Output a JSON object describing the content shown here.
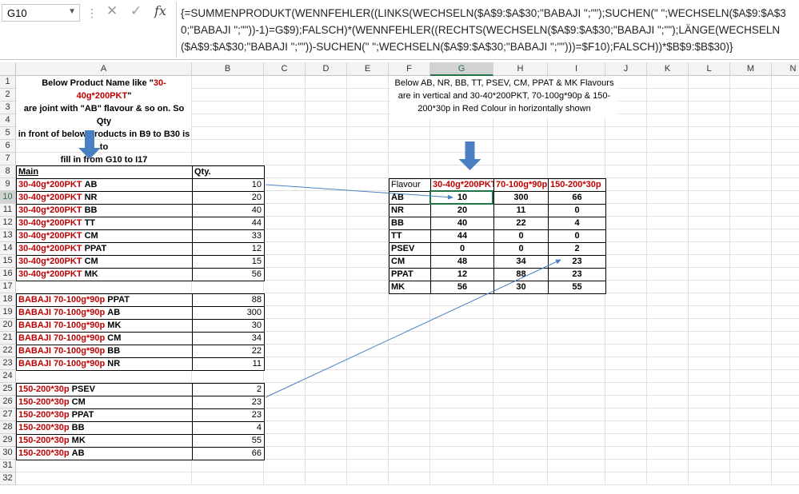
{
  "namebox": {
    "value": "G10"
  },
  "formula": "{=SUMMENPRODUKT(WENNFEHLER((LINKS(WECHSELN($A$9:$A$30;\"BABAJI \";\"\");SUCHEN(\" \";WECHSELN($A$9:$A$30;\"BABAJI \";\"\"))-1)=G$9);FALSCH)*(WENNFEHLER((RECHTS(WECHSELN($A$9:$A$30;\"BABAJI \";\"\");LÄNGE(WECHSELN($A$9:$A$30;\"BABAJI \";\"\"))-SUCHEN(\" \";WECHSELN($A$9:$A$30;\"BABAJI \";\"\")))=$F10);FALSCH))*$B$9:$B$30)}",
  "columns": [
    "A",
    "B",
    "C",
    "D",
    "E",
    "F",
    "G",
    "H",
    "I",
    "J",
    "K",
    "L",
    "M",
    "N"
  ],
  "rows": [
    "1",
    "2",
    "3",
    "4",
    "5",
    "6",
    "7",
    "8",
    "9",
    "10",
    "11",
    "12",
    "13",
    "14",
    "15",
    "16",
    "17",
    "18",
    "19",
    "20",
    "21",
    "22",
    "23",
    "24",
    "25",
    "26",
    "27",
    "28",
    "29",
    "30",
    "31",
    "32"
  ],
  "note_left": {
    "l1a": "Below Product Name like \"",
    "l1b": "30-40g*200PKT",
    "l1c": "\"",
    "l2": "are joint with \"AB\" flavour & so on. So Qty",
    "l3": "in front of below products in B9 to B30 is to",
    "l4": "fill in from G10 to I17"
  },
  "note_right": {
    "p1": "Below ",
    "p2": "AB, NR, BB, TT, PSEV, CM, PPAT & MK",
    "p3": " Flavours",
    "p4": "are in vertical and ",
    "p5": "30-40*200PKT, 70-100g*90p & 150-",
    "p6": "200*30p",
    "p7": " in Red Colour in horizontally shown"
  },
  "left_header": {
    "main": "Main",
    "qty": "Qty."
  },
  "left_table": [
    {
      "row": "9",
      "prod": "30-40g*200PKT",
      "flav": "AB",
      "qty": "10"
    },
    {
      "row": "10",
      "prod": "30-40g*200PKT",
      "flav": "NR",
      "qty": "20"
    },
    {
      "row": "11",
      "prod": "30-40g*200PKT",
      "flav": "BB",
      "qty": "40"
    },
    {
      "row": "12",
      "prod": "30-40g*200PKT",
      "flav": "TT",
      "qty": "44"
    },
    {
      "row": "13",
      "prod": "30-40g*200PKT",
      "flav": "CM",
      "qty": "33"
    },
    {
      "row": "14",
      "prod": "30-40g*200PKT",
      "flav": "PPAT",
      "qty": "12"
    },
    {
      "row": "15",
      "prod": "30-40g*200PKT",
      "flav": "CM",
      "qty": "15"
    },
    {
      "row": "16",
      "prod": "30-40g*200PKT",
      "flav": "MK",
      "qty": "56"
    },
    {
      "row": "18",
      "prod": "BABAJI 70-100g*90p",
      "flav": "PPAT",
      "qty": "88"
    },
    {
      "row": "19",
      "prod": "BABAJI 70-100g*90p",
      "flav": "AB",
      "qty": "300"
    },
    {
      "row": "20",
      "prod": "BABAJI 70-100g*90p",
      "flav": "MK",
      "qty": "30"
    },
    {
      "row": "21",
      "prod": "BABAJI 70-100g*90p",
      "flav": "CM",
      "qty": "34"
    },
    {
      "row": "22",
      "prod": "BABAJI 70-100g*90p",
      "flav": "BB",
      "qty": "22"
    },
    {
      "row": "23",
      "prod": "BABAJI 70-100g*90p",
      "flav": "NR",
      "qty": "11"
    },
    {
      "row": "25",
      "prod": "150-200*30p",
      "flav": "PSEV",
      "qty": "2"
    },
    {
      "row": "26",
      "prod": "150-200*30p",
      "flav": "CM",
      "qty": "23"
    },
    {
      "row": "27",
      "prod": "150-200*30p",
      "flav": "PPAT",
      "qty": "23"
    },
    {
      "row": "28",
      "prod": "150-200*30p",
      "flav": "BB",
      "qty": "4"
    },
    {
      "row": "29",
      "prod": "150-200*30p",
      "flav": "MK",
      "qty": "55"
    },
    {
      "row": "30",
      "prod": "150-200*30p",
      "flav": "AB",
      "qty": "66"
    }
  ],
  "right_header": [
    "Flavour",
    "30-40g*200PKT",
    "70-100g*90p",
    "150-200*30p"
  ],
  "right_table": [
    [
      "AB",
      "10",
      "300",
      "66"
    ],
    [
      "NR",
      "20",
      "11",
      "0"
    ],
    [
      "BB",
      "40",
      "22",
      "4"
    ],
    [
      "TT",
      "44",
      "0",
      "0"
    ],
    [
      "PSEV",
      "0",
      "0",
      "2"
    ],
    [
      "CM",
      "48",
      "34",
      "23"
    ],
    [
      "PPAT",
      "12",
      "88",
      "23"
    ],
    [
      "MK",
      "56",
      "30",
      "55"
    ]
  ],
  "colors": {
    "red": "#c00000",
    "arrow": "#4a7fc1",
    "selection": "#217346"
  }
}
